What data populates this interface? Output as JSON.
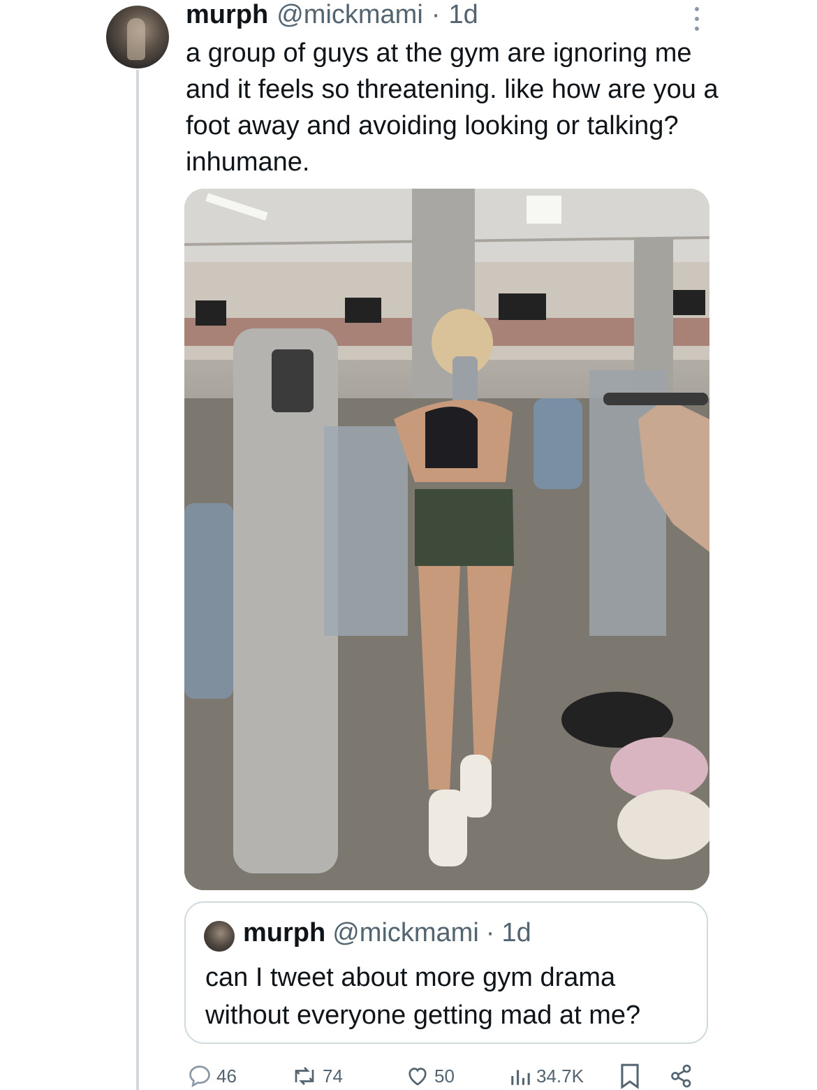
{
  "tweet": {
    "display_name": "murph",
    "handle": "@mickmami",
    "separator": "·",
    "time": "1d",
    "text": "a group of guys at the gym are ignoring me and it feels so threatening. like how are you a foot away and avoiding looking or talking? inhumane."
  },
  "quoted_tweet": {
    "display_name": "murph",
    "handle": "@mickmami",
    "separator": "·",
    "time": "1d",
    "text": "can I tweet about more gym drama without everyone getting mad at me?"
  },
  "actions": {
    "replies": "46",
    "reposts": "74",
    "likes": "50",
    "views": "34.7K"
  },
  "icons": {
    "more": "more-icon",
    "reply": "reply-icon",
    "repost": "repost-icon",
    "like": "heart-icon",
    "views": "views-chart-icon",
    "bookmark": "bookmark-icon",
    "share": "share-icon"
  },
  "colors": {
    "text": "#0f1419",
    "secondary": "#536471",
    "border": "#cfd9de"
  }
}
